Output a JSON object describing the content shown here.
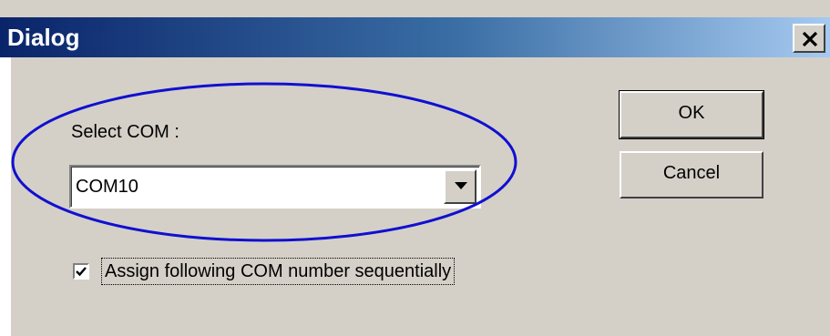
{
  "window": {
    "title": "Dialog",
    "close_icon": "close-icon"
  },
  "form": {
    "select_label": "Select COM :",
    "com_value": "COM10",
    "dropdown_icon": "chevron-down-icon",
    "checkbox_label": "Assign following COM number sequentially",
    "checkbox_checked": true
  },
  "buttons": {
    "ok_label": "OK",
    "cancel_label": "Cancel"
  },
  "annotation": {
    "color": "#1010d0"
  }
}
